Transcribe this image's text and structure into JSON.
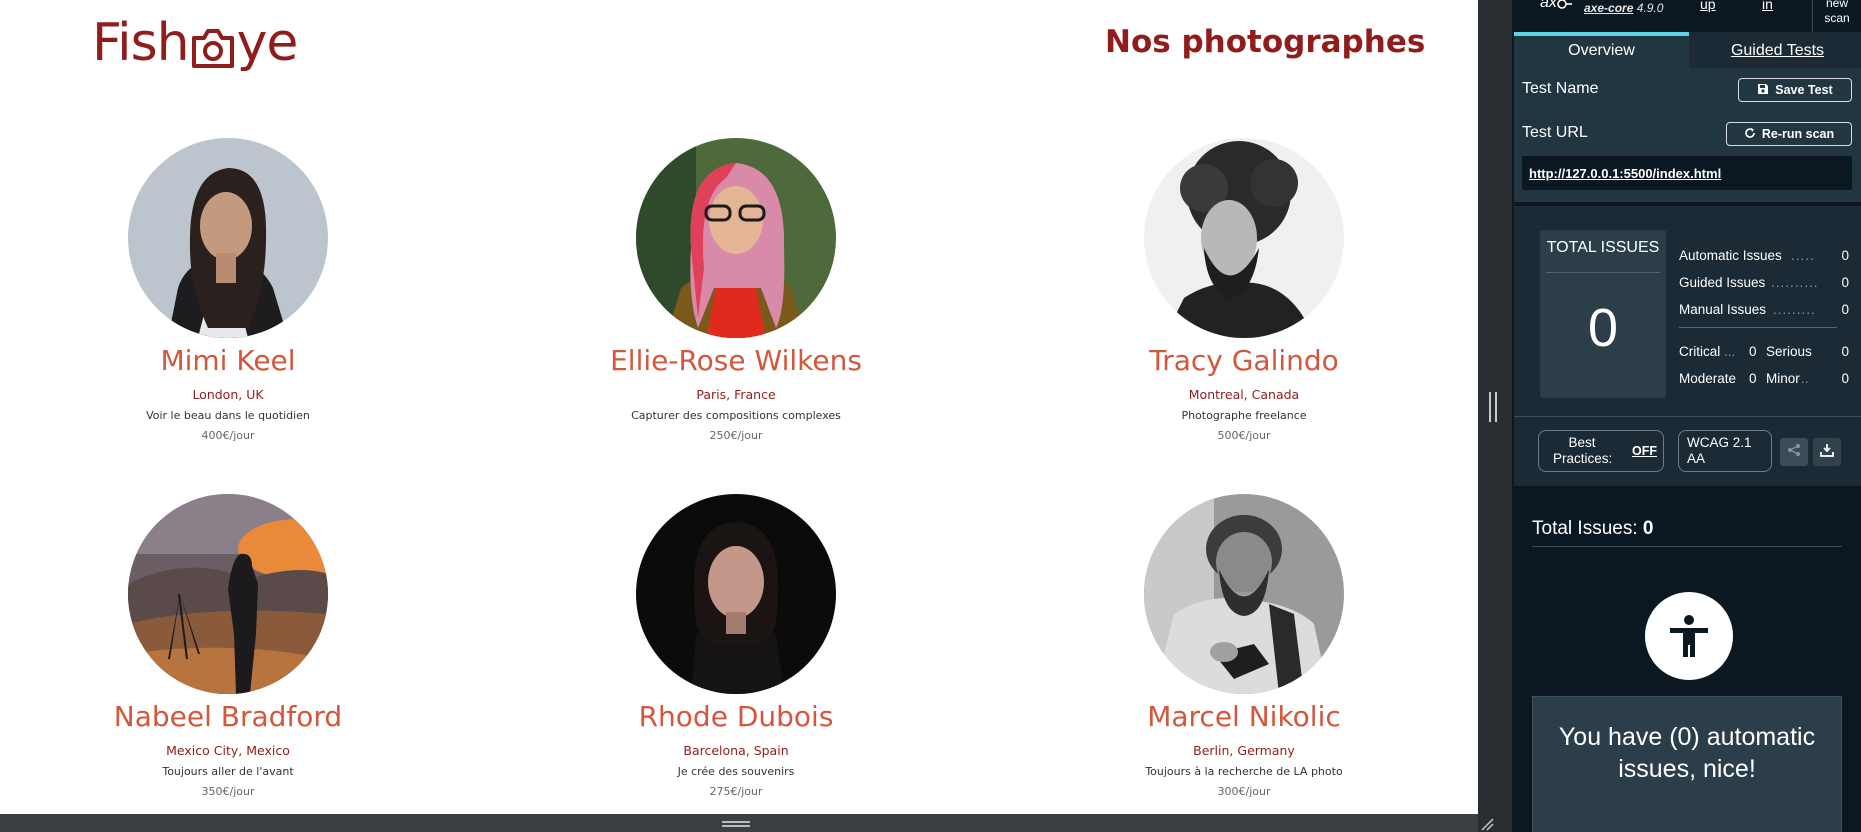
{
  "page": {
    "logo": {
      "text_before": "Fish",
      "text_after": "ye",
      "icon": "camera-icon"
    },
    "heading": "Nos photographes",
    "photographers": [
      {
        "name": "Mimi Keel",
        "location": "London, UK",
        "tagline": "Voir le beau dans le quotidien",
        "price": "400€/jour"
      },
      {
        "name": "Ellie-Rose Wilkens",
        "location": "Paris, France",
        "tagline": "Capturer des compositions complexes",
        "price": "250€/jour"
      },
      {
        "name": "Tracy Galindo",
        "location": "Montreal, Canada",
        "tagline": "Photographe freelance",
        "price": "500€/jour"
      },
      {
        "name": "Nabeel Bradford",
        "location": "Mexico City, Mexico",
        "tagline": "Toujours aller de l'avant",
        "price": "350€/jour"
      },
      {
        "name": "Rhode Dubois",
        "location": "Barcelona, Spain",
        "tagline": "Je crée des souvenirs",
        "price": "275€/jour"
      },
      {
        "name": "Marcel Nikolic",
        "location": "Berlin, Germany",
        "tagline": "Toujours à la recherche de LA photo",
        "price": "300€/jour"
      }
    ]
  },
  "axe": {
    "logo": "ax",
    "version_name": "axe-core",
    "version_number": "4.9.0",
    "top_links": [
      "up",
      "in"
    ],
    "new_scan": [
      "new",
      "scan"
    ],
    "tabs": {
      "overview": "Overview",
      "guided": "Guided Tests"
    },
    "test_name_label": "Test Name",
    "save_test": "Save Test",
    "test_url_label": "Test URL",
    "rerun": "Re-run scan",
    "url": "http://127.0.0.1:5500/index.html",
    "total_issues_label": "TOTAL ISSUES",
    "total_issues": "0",
    "counts": [
      {
        "label": "Automatic Issues",
        "value": "0"
      },
      {
        "label": "Guided Issues",
        "value": "0"
      },
      {
        "label": "Manual Issues",
        "value": "0"
      }
    ],
    "severity": {
      "critical_label": "Critical",
      "critical": "0",
      "serious_label": "Serious",
      "serious": "0",
      "moderate_label": "Moderate",
      "moderate": "0",
      "minor_label": "Minor",
      "minor": "0"
    },
    "best_practices_label_1": "Best",
    "best_practices_label_2": "Practices:",
    "best_practices_state": "OFF",
    "wcag_line_1": "WCAG 2.1",
    "wcag_line_2": "AA",
    "results_title": "Total Issues:",
    "results_count": "0",
    "nice_message": "You have (0) automatic issues, nice!"
  }
}
